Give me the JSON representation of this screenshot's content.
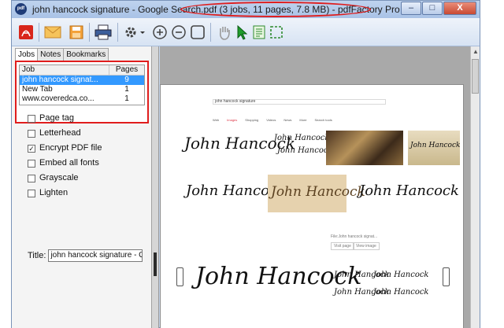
{
  "window": {
    "app_badge": "pdf",
    "title": "john hancock signature - Google Search.pdf (3 jobs, 11 pages, 7.8 MB) - pdfFactory Pro",
    "controls": {
      "minimize": "–",
      "maximize": "□",
      "close": "X"
    }
  },
  "toolbar": {
    "icons": [
      "acrobat-icon",
      "email-icon",
      "save-icon",
      "print-icon",
      "gear-icon",
      "zoom-in-icon",
      "zoom-out-icon",
      "fit-page-icon",
      "hand-icon",
      "select-arrow-icon",
      "text-select-icon",
      "crop-icon"
    ]
  },
  "tabs": [
    {
      "label": "Jobs",
      "active": true
    },
    {
      "label": "Notes",
      "active": false
    },
    {
      "label": "Bookmarks",
      "active": false
    }
  ],
  "jobs": {
    "col_job": "Job",
    "col_pages": "Pages",
    "rows": [
      {
        "job": "john hancock signat...",
        "pages": "9",
        "selected": true
      },
      {
        "job": "New Tab",
        "pages": "1",
        "selected": false
      },
      {
        "job": "www.coveredca.co...",
        "pages": "1",
        "selected": false
      }
    ]
  },
  "options": [
    {
      "label": "Page tag",
      "checked": false
    },
    {
      "label": "Letterhead",
      "checked": false
    },
    {
      "label": "Encrypt PDF file",
      "checked": true
    },
    {
      "label": "Embed all fonts",
      "checked": false
    },
    {
      "label": "Grayscale",
      "checked": false
    },
    {
      "label": "Lighten",
      "checked": false
    }
  ],
  "title_field": {
    "label": "Title:",
    "value": "john hancock signature - Goo"
  },
  "preview": {
    "search_query": "john hancock signature",
    "search_tabs": [
      "Web",
      "Images",
      "Shopping",
      "Videos",
      "News",
      "More",
      "Search tools"
    ],
    "signature_text": "John Hancock",
    "colors": {
      "highlight": "#e01d1d",
      "selection": "#3399ff"
    }
  }
}
